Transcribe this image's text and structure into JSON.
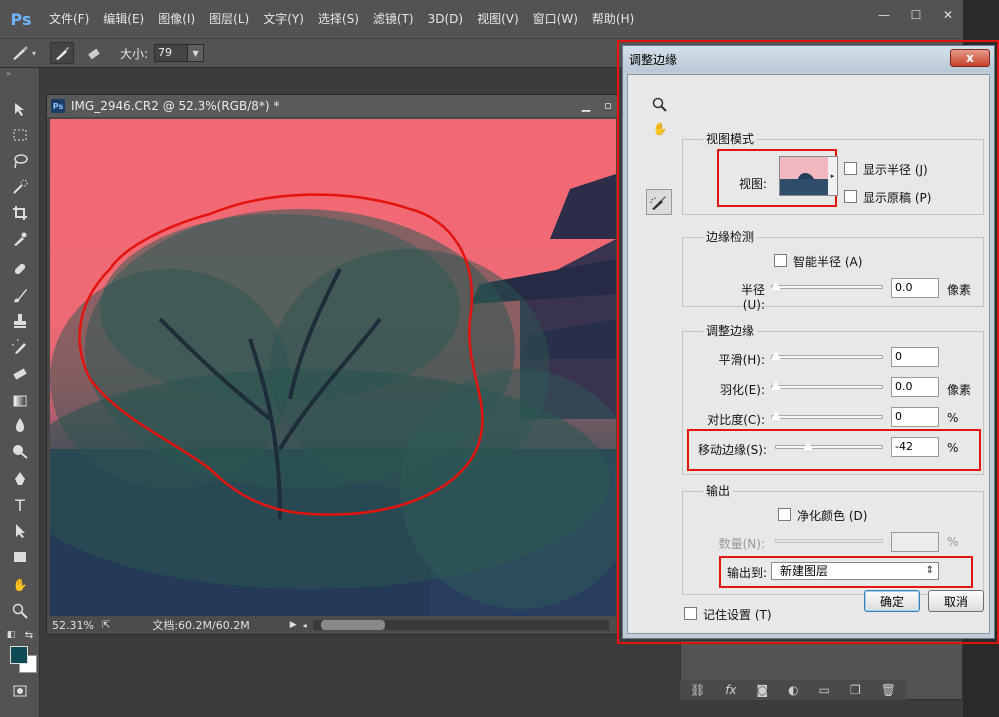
{
  "app": {
    "logo": "Ps",
    "menu": [
      "文件(F)",
      "编辑(E)",
      "图像(I)",
      "图层(L)",
      "文字(Y)",
      "选择(S)",
      "滤镜(T)",
      "3D(D)",
      "视图(V)",
      "窗口(W)",
      "帮助(H)"
    ],
    "window_controls": [
      "—",
      "☐",
      "✕"
    ]
  },
  "options_bar": {
    "size_label": "大小:",
    "size_value": "79"
  },
  "document": {
    "title": "IMG_2946.CR2 @ 52.3%(RGB/8*) *",
    "zoom": "52.31%",
    "doc_info": "文档:60.2M/60.2M"
  },
  "dialog": {
    "title": "调整边缘",
    "close_label": "x",
    "view_mode": {
      "title": "视图模式",
      "view_label": "视图:",
      "show_radius": "显示半径 (J)",
      "show_original": "显示原稿 (P)"
    },
    "edge_detection": {
      "title": "边缘检测",
      "smart_radius": "智能半径 (A)",
      "radius_label": "半径(U):",
      "radius_value": "0.0",
      "radius_unit": "像素"
    },
    "adjust_edge": {
      "title": "调整边缘",
      "smooth_label": "平滑(H):",
      "smooth_value": "0",
      "feather_label": "羽化(E):",
      "feather_value": "0.0",
      "feather_unit": "像素",
      "contrast_label": "对比度(C):",
      "contrast_value": "0",
      "contrast_unit": "%",
      "shift_label": "移动边缘(S):",
      "shift_value": "-42",
      "shift_unit": "%"
    },
    "output": {
      "title": "输出",
      "decontaminate": "净化颜色 (D)",
      "amount_label": "数量(N):",
      "amount_unit": "%",
      "output_to_label": "输出到:",
      "output_to_value": "新建图层"
    },
    "remember": "记住设置 (T)",
    "ok": "确定",
    "cancel": "取消"
  },
  "colors": {
    "highlight": "#e3140f",
    "sky_overlay": "#f06873",
    "foreground": "#0f4a55"
  }
}
